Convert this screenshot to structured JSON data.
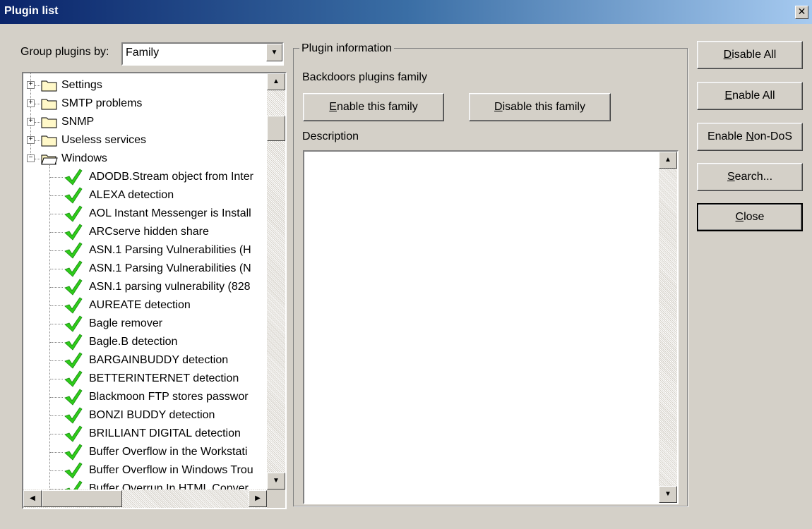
{
  "window": {
    "title": "Plugin list",
    "close_glyph": "✕"
  },
  "group_by": {
    "label": "Group plugins by:",
    "value": "Family"
  },
  "tree": {
    "folders": [
      {
        "label": "Settings",
        "expanded": false
      },
      {
        "label": "SMTP problems",
        "expanded": false
      },
      {
        "label": "SNMP",
        "expanded": false
      },
      {
        "label": "Useless services",
        "expanded": false
      },
      {
        "label": "Windows",
        "expanded": true
      }
    ],
    "plugins": [
      "ADODB.Stream object from Inter",
      "ALEXA detection",
      "AOL Instant Messenger is Install",
      "ARCserve hidden share",
      "ASN.1 Parsing Vulnerabilities (H",
      "ASN.1 Parsing Vulnerabilities (N",
      "ASN.1 parsing vulnerability (828",
      "AUREATE detection",
      "Bagle remover",
      "Bagle.B detection",
      "BARGAINBUDDY detection",
      "BETTERINTERNET detection",
      "Blackmoon FTP stores passwor",
      "BONZI BUDDY detection",
      "BRILLIANT DIGITAL detection",
      "Buffer Overflow in the Workstati",
      "Buffer Overflow in Windows Trou",
      "Buffer Overrun In HTML Conver"
    ],
    "check_color": "#2ecc1a"
  },
  "plugin_info": {
    "group_label": "Plugin information",
    "family_text": "Backdoors plugins family",
    "enable_family": {
      "pre": "",
      "key": "E",
      "post": "nable this family"
    },
    "disable_family": {
      "pre": "",
      "key": "D",
      "post": "isable this family"
    },
    "description_label": "Description"
  },
  "side_buttons": {
    "disable_all": {
      "pre": "",
      "key": "D",
      "post": "isable All"
    },
    "enable_all": {
      "pre": "",
      "key": "E",
      "post": "nable All"
    },
    "enable_non_dos": {
      "pre": "Enable ",
      "key": "N",
      "post": "on-DoS"
    },
    "search": {
      "pre": "",
      "key": "S",
      "post": "earch..."
    },
    "close": {
      "pre": "",
      "key": "C",
      "post": "lose"
    }
  }
}
